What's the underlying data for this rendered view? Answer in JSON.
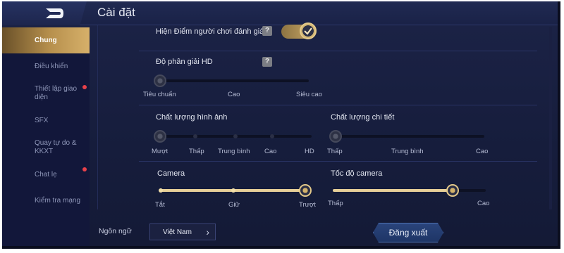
{
  "header": {
    "title": "Cài đặt"
  },
  "sidebar": {
    "items": [
      {
        "label": "Chung",
        "active": true,
        "badge": false
      },
      {
        "label": "Điều khiển",
        "active": false,
        "badge": false
      },
      {
        "label": "Thiết lập giao diện",
        "active": false,
        "badge": true
      },
      {
        "label": "SFX",
        "active": false,
        "badge": false
      },
      {
        "label": "Quay tự do & KKXT",
        "active": false,
        "badge": false
      },
      {
        "label": "Chat lẹ",
        "active": false,
        "badge": true
      },
      {
        "label": "Kiểm tra mạng",
        "active": false,
        "badge": false
      }
    ]
  },
  "settings": {
    "show_rating": {
      "label": "Hiện Điểm người chơi đánh giá",
      "help": "?",
      "enabled": true
    },
    "resolution": {
      "label": "Độ phân giải HD",
      "help": "?",
      "options": [
        "Tiêu chuẩn",
        "Cao",
        "Siêu cao"
      ],
      "selected_index": 0
    },
    "image_quality": {
      "label": "Chất lượng hình ảnh",
      "options": [
        "Mượt",
        "Thấp",
        "Trung bình",
        "Cao",
        "HD"
      ],
      "selected_index": 0
    },
    "detail_quality": {
      "label": "Chất lượng chi tiết",
      "options": [
        "Thấp",
        "Trung bình",
        "Cao"
      ],
      "selected_index": 0
    },
    "camera": {
      "label": "Camera",
      "options": [
        "Tắt",
        "Giữ",
        "Trượt"
      ],
      "selected_index": 2
    },
    "camera_speed": {
      "label": "Tốc độ camera",
      "min_label": "Thấp",
      "max_label": "Cao",
      "level": 0.8
    }
  },
  "footer": {
    "language_label": "Ngôn ngữ",
    "language_value": "Việt Nam",
    "logout_label": "Đăng xuất"
  },
  "colors": {
    "accent_gold": "#e3c98a",
    "background": "#161d3c",
    "badge_red": "#e8414a"
  }
}
